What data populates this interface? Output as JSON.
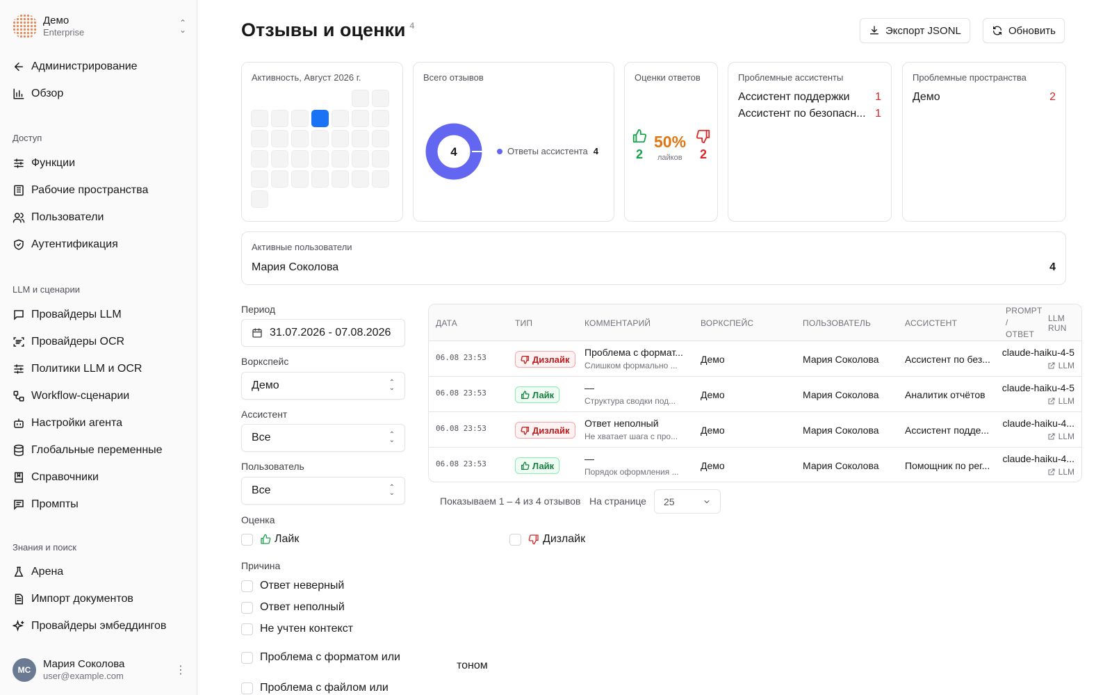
{
  "org": {
    "name": "Демо",
    "plan": "Enterprise"
  },
  "nav": {
    "admin": "Администрирование",
    "overview": "Обзор",
    "section_access": "Доступ",
    "functions": "Функции",
    "workspaces": "Рабочие пространства",
    "users": "Пользователи",
    "auth": "Аутентификация",
    "section_llm": "LLM и сценарии",
    "llm_providers": "Провайдеры LLM",
    "ocr_providers": "Провайдеры OCR",
    "policies": "Политики LLM и OCR",
    "workflows": "Workflow-сценарии",
    "agent_settings": "Настройки агента",
    "global_vars": "Глобальные переменные",
    "dictionaries": "Справочники",
    "prompts": "Промпты",
    "section_knowledge": "Знания и поиск",
    "arena": "Арена",
    "doc_import": "Импорт документов",
    "embedding_providers": "Провайдеры эмбеддингов"
  },
  "user": {
    "initials": "МС",
    "name": "Мария Соколова",
    "email": "user@example.com"
  },
  "page": {
    "title": "Отзывы и оценки",
    "count": "4"
  },
  "actions": {
    "export": "Экспорт JSONL",
    "refresh": "Обновить"
  },
  "cards": {
    "activity": {
      "title": "Активность, Август 2026 г.",
      "active_day": 6
    },
    "total": {
      "title": "Всего отзывов",
      "value": "4",
      "legend_label": "Ответы ассистента",
      "legend_value": "4"
    },
    "ratings": {
      "title": "Оценки ответов",
      "percent": "50%",
      "sub": "лайков",
      "likes": "2",
      "dislikes": "2",
      "like_share": 0.5
    },
    "problem_assistants": {
      "title": "Проблемные ассистенты",
      "items": [
        {
          "name": "Ассистент поддержки",
          "count": "1"
        },
        {
          "name": "Ассистент по безопасн...",
          "count": "1"
        }
      ]
    },
    "problem_spaces": {
      "title": "Проблемные пространства",
      "items": [
        {
          "name": "Демо",
          "count": "2"
        }
      ]
    },
    "active_users": {
      "title": "Активные пользователи",
      "name": "Мария Соколова",
      "count": "4"
    }
  },
  "filters": {
    "period_label": "Период",
    "period_value": "31.07.2026 - 07.08.2026",
    "workspace_label": "Воркспейс",
    "workspace_value": "Демо",
    "assistant_label": "Ассистент",
    "assistant_value": "Все",
    "user_label": "Пользователь",
    "user_value": "Все",
    "rating_label": "Оценка",
    "rating_like": "Лайк",
    "rating_dislike": "Дизлайк",
    "reason_label": "Причина",
    "reasons": [
      "Ответ неверный",
      "Ответ неполный",
      "Не учтен контекст",
      "Проблема с форматом или",
      "тоном",
      "Проблема с файлом или"
    ]
  },
  "table": {
    "headers": {
      "date": "Дата",
      "type": "Тип",
      "comment": "Комментарий",
      "workspace": "Воркспейс",
      "user": "Пользователь",
      "assistant": "Ассистент",
      "prompt": "Prompt",
      "slash": "/",
      "answer": "Ответ",
      "llm_run": "LLM run"
    },
    "rows": [
      {
        "date": "06.08 23:53",
        "type": "Дизлайк",
        "kind": "dislike",
        "comment": "Проблема с формат...",
        "sub": "Слишком формально ...",
        "workspace": "Демо",
        "user": "Мария Соколова",
        "assistant": "Ассистент по без...",
        "model": "claude-haiku-4-5",
        "link": "LLM"
      },
      {
        "date": "06.08 23:53",
        "type": "Лайк",
        "kind": "like",
        "comment": "—",
        "sub": "Структура сводки под...",
        "workspace": "Демо",
        "user": "Мария Соколова",
        "assistant": "Аналитик отчётов",
        "model": "claude-haiku-4-5",
        "link": "LLM"
      },
      {
        "date": "06.08 23:53",
        "type": "Дизлайк",
        "kind": "dislike",
        "comment": "Ответ неполный",
        "sub": "Не хватает шага с про...",
        "workspace": "Демо",
        "user": "Мария Соколова",
        "assistant": "Ассистент подде...",
        "model": "claude-haiku-4...",
        "link": "LLM"
      },
      {
        "date": "06.08 23:53",
        "type": "Лайк",
        "kind": "like",
        "comment": "—",
        "sub": "Порядок оформления ...",
        "workspace": "Демо",
        "user": "Мария Соколова",
        "assistant": "Помощник по рег...",
        "model": "claude-haiku-4...",
        "link": "LLM"
      }
    ]
  },
  "pager": {
    "summary": "Показываем 1 – 4 из 4 отзывов",
    "per_page_label": "На странице",
    "per_page_value": "25"
  },
  "colors": {
    "accent": "#1a73f5",
    "like": "#16a34a",
    "dislike": "#dc2626",
    "donut": "#6366f1",
    "percent": "#e07612"
  }
}
